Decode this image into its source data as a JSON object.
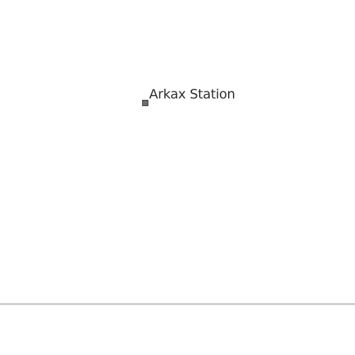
{
  "map": {
    "station": {
      "label": "Arkax Station",
      "marker_icon": "square-marker-icon",
      "marker_color": "#6f6f6f"
    },
    "line_color": "#cfcfcf"
  }
}
